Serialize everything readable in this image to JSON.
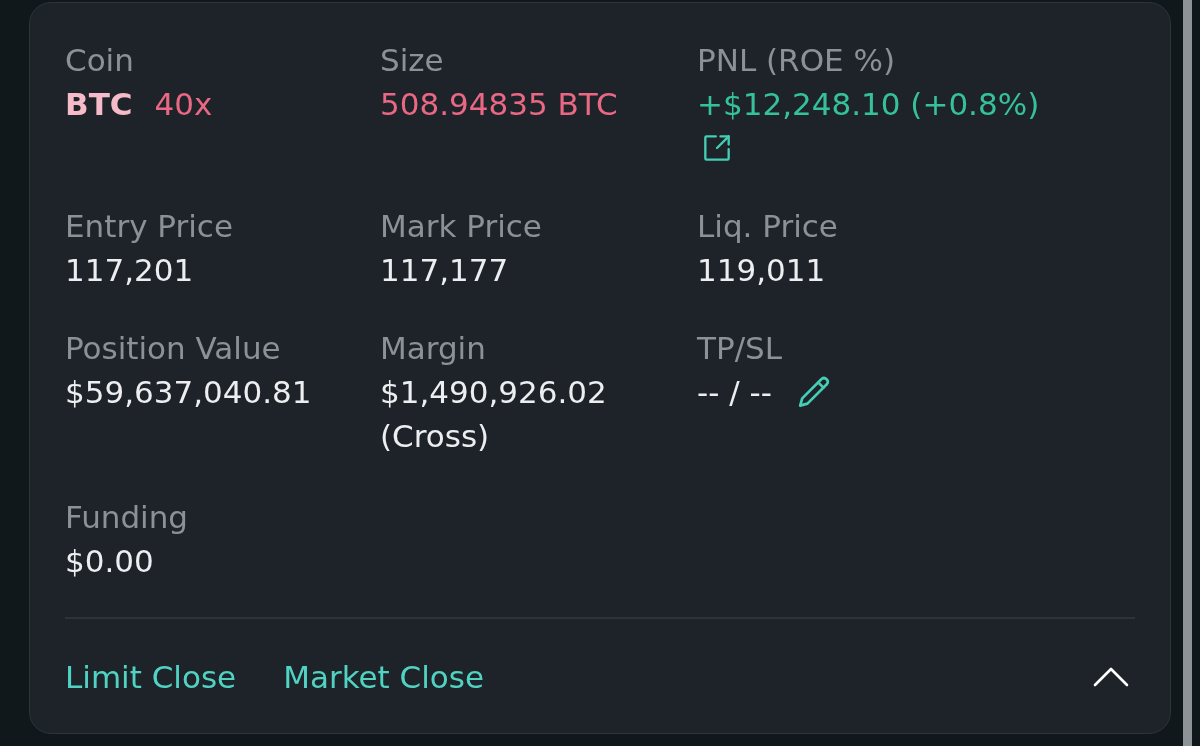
{
  "position": {
    "fields": [
      {
        "kind": "coin",
        "label": "Coin",
        "symbol": "BTC",
        "leverage": "40x",
        "color": "#ea6884"
      },
      {
        "kind": "stat",
        "label": "Size",
        "value": "508.94835 BTC",
        "color": "#ea6884",
        "share_link": false,
        "editable": false
      },
      {
        "kind": "stat",
        "label": "PNL (ROE %)",
        "value": "+$12,248.10 (+0.8%)",
        "color": "#35c29a",
        "share_link": true,
        "editable": false
      },
      {
        "kind": "stat",
        "label": "Entry Price",
        "value": "117,201",
        "color": "#eceef0",
        "share_link": false,
        "editable": false
      },
      {
        "kind": "stat",
        "label": "Mark Price",
        "value": "117,177",
        "color": "#eceef0",
        "share_link": false,
        "editable": false
      },
      {
        "kind": "stat",
        "label": "Liq. Price",
        "value": "119,011",
        "color": "#eceef0",
        "share_link": false,
        "editable": false
      },
      {
        "kind": "stat",
        "label": "Position Value",
        "value": "$59,637,040.81",
        "color": "#eceef0",
        "share_link": false,
        "editable": false
      },
      {
        "kind": "stat",
        "label": "Margin",
        "value": "$1,490,926.02",
        "note": "(Cross)",
        "color": "#eceef0",
        "share_link": false,
        "editable": false
      },
      {
        "kind": "stat",
        "label": "TP/SL",
        "value": "-- / --",
        "color": "#eceef0",
        "share_link": false,
        "editable": true
      },
      {
        "kind": "stat",
        "label": "Funding",
        "value": "$0.00",
        "color": "#eceef0",
        "share_link": false,
        "editable": false
      }
    ],
    "actions": [
      {
        "label": "Limit Close"
      },
      {
        "label": "Market Close"
      }
    ],
    "expanded": true
  }
}
